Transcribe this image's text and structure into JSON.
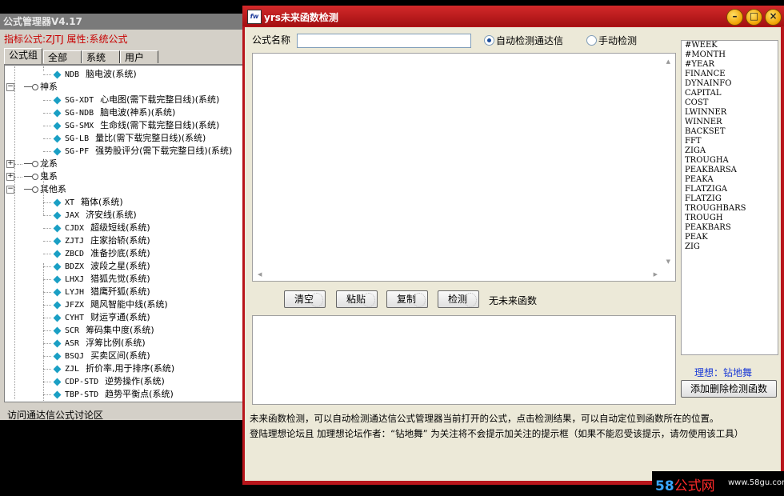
{
  "manager": {
    "title": "公式管理器V4.17",
    "info": "指标公式:ZJTJ 属性:系统公式",
    "tabs": [
      "公式组",
      "全部",
      "系统",
      "用户"
    ],
    "tree": [
      {
        "type": "leaf",
        "code": "NDB",
        "name": "脑电波(系统)"
      },
      {
        "type": "group",
        "name": "神系",
        "expanded": true
      },
      {
        "type": "leaf",
        "code": "SG-XDT",
        "name": "心电图(需下载完整日线)(系统)"
      },
      {
        "type": "leaf",
        "code": "SG-NDB",
        "name": "脑电波(神系)(系统)"
      },
      {
        "type": "leaf",
        "code": "SG-SMX",
        "name": "生命线(需下载完整日线)(系统)"
      },
      {
        "type": "leaf",
        "code": "SG-LB",
        "name": "量比(需下载完整日线)(系统)"
      },
      {
        "type": "leaf",
        "code": "SG-PF",
        "name": "强势股评分(需下载完整日线)(系统)"
      },
      {
        "type": "group",
        "name": "龙系",
        "expanded": false
      },
      {
        "type": "group",
        "name": "鬼系",
        "expanded": false
      },
      {
        "type": "group",
        "name": "其他系",
        "expanded": true
      },
      {
        "type": "leaf",
        "code": "XT",
        "name": "箱体(系统)"
      },
      {
        "type": "leaf",
        "code": "JAX",
        "name": "济安线(系统)"
      },
      {
        "type": "leaf",
        "code": "CJDX",
        "name": "超级短线(系统)"
      },
      {
        "type": "leaf",
        "code": "ZJTJ",
        "name": "庄家抬轿(系统)"
      },
      {
        "type": "leaf",
        "code": "ZBCD",
        "name": "准备抄底(系统)"
      },
      {
        "type": "leaf",
        "code": "BDZX",
        "name": "波段之星(系统)"
      },
      {
        "type": "leaf",
        "code": "LHXJ",
        "name": "猎狐先觉(系统)"
      },
      {
        "type": "leaf",
        "code": "LYJH",
        "name": "猎鹰歼狐(系统)"
      },
      {
        "type": "leaf",
        "code": "JFZX",
        "name": "飓风智能中线(系统)"
      },
      {
        "type": "leaf",
        "code": "CYHT",
        "name": "财运亨通(系统)"
      },
      {
        "type": "leaf",
        "code": "SCR",
        "name": "筹码集中度(系统)"
      },
      {
        "type": "leaf",
        "code": "ASR",
        "name": "浮筹比例(系统)"
      },
      {
        "type": "leaf",
        "code": "BSQJ",
        "name": "买卖区间(系统)"
      },
      {
        "type": "leaf",
        "code": "ZJL",
        "name": "折价率,用于排序(系统)"
      },
      {
        "type": "leaf",
        "code": "CDP-STD",
        "name": "逆势操作(系统)"
      },
      {
        "type": "leaf",
        "code": "TBP-STD",
        "name": "趋势平衡点(系统)"
      }
    ],
    "footer_link": "访问通达信公式讨论区"
  },
  "checker": {
    "title": "yrs未来函数检测",
    "app_icon_text": "fw",
    "formula_name_label": "公式名称",
    "formula_name_value": "",
    "radio_auto": "自动检测通达信",
    "radio_manual": "手动检测",
    "radio_selected": "auto",
    "buttons": {
      "clear": "清空",
      "paste": "粘贴",
      "copy": "复制",
      "check": "检测"
    },
    "status": "无未来函数",
    "functions": [
      "#WEEK",
      "#MONTH",
      "#YEAR",
      "FINANCE",
      "DYNAINFO",
      "CAPITAL",
      "COST",
      "LWINNER",
      "WINNER",
      "BACKSET",
      "FFT",
      "ZIGA",
      "TROUGHA",
      "PEAKBARSA",
      "PEAKA",
      "FLATZIGA",
      "FLATZIG",
      "TROUGHBARS",
      "TROUGH",
      "PEAKBARS",
      "PEAK",
      "ZIG"
    ],
    "author": "理想：钻地舞",
    "toggle_button": "添加删除检测函数",
    "desc1": "未来函数检测，可以自动检测通达信公式管理器当前打开的公式，点击检测结果，可以自动定位到函数所在的位置。",
    "desc2": "登陆理想论坛且 加理想论坛作者：“钻地舞” 为关注将不会提示加关注的提示框（如果不能忍受该提示，请勿使用该工具）",
    "window_controls": [
      "minimize-icon",
      "maximize-icon",
      "close-icon"
    ]
  },
  "watermark": {
    "num": "58",
    "zh": "公式网",
    "url": "www.58gu.com"
  },
  "colors": {
    "titlebar": "#b8151b",
    "info_red": "#c80000",
    "author_blue": "#1a3ad6"
  }
}
